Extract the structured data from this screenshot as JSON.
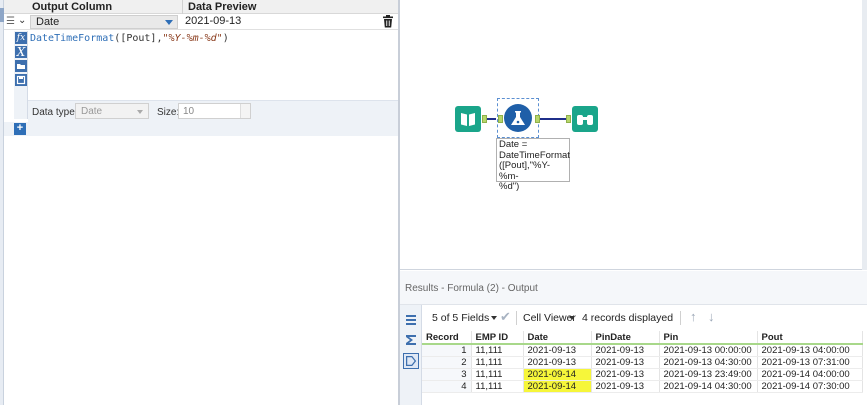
{
  "config": {
    "header": {
      "output_column": "Output Column",
      "data_preview": "Data Preview"
    },
    "row": {
      "field": "Date",
      "preview": "2021-09-13"
    },
    "expression": {
      "fn": "DateTimeFormat",
      "arg": "[Pout]",
      "format": "\"%Y-%m-%d\""
    },
    "datatype": {
      "label": "Data type:",
      "value": "Date",
      "size_label": "Size:",
      "size_value": "10"
    }
  },
  "canvas": {
    "annotation": "Date =\nDateTimeFormat\n([Pout],\"%Y-%m-\n%d\")"
  },
  "results": {
    "title": "Results - Formula (2) - Output",
    "fields_selector": "5 of 5 Fields",
    "viewer": "Cell Viewer",
    "records_displayed": "4 records displayed",
    "columns": [
      "Record",
      "EMP ID",
      "Date",
      "PinDate",
      "Pin",
      "Pout"
    ],
    "rows": [
      {
        "record": "1",
        "emp": "11,111",
        "date": "2021-09-13",
        "pindate": "2021-09-13",
        "pin": "2021-09-13 00:00:00",
        "pout": "2021-09-13 04:00:00",
        "highlight": false
      },
      {
        "record": "2",
        "emp": "11,111",
        "date": "2021-09-13",
        "pindate": "2021-09-13",
        "pin": "2021-09-13 04:30:00",
        "pout": "2021-09-13 07:31:00",
        "highlight": false
      },
      {
        "record": "3",
        "emp": "11,111",
        "date": "2021-09-14",
        "pindate": "2021-09-13",
        "pin": "2021-09-13 23:49:00",
        "pout": "2021-09-14 04:00:00",
        "highlight": true
      },
      {
        "record": "4",
        "emp": "11,111",
        "date": "2021-09-14",
        "pindate": "2021-09-13",
        "pin": "2021-09-14 04:30:00",
        "pout": "2021-09-14 07:30:00",
        "highlight": true
      }
    ],
    "highlight_color": "#f6f63a"
  },
  "colors": {
    "accent": "#2f6fb7",
    "input_tool": "#1aa58a",
    "formula_tool": "#1f5fa8",
    "browse_tool": "#1aa58a",
    "wire": "#1f2f8a"
  },
  "icons": [
    "list-icon",
    "chevron-down-icon",
    "trash-icon",
    "fx-icon",
    "x-variable-icon",
    "folder-icon",
    "save-icon",
    "plus-icon",
    "input-data-tool-icon",
    "formula-tool-icon",
    "browse-tool-icon",
    "checkmark-icon",
    "arrow-up-icon",
    "arrow-down-icon"
  ]
}
